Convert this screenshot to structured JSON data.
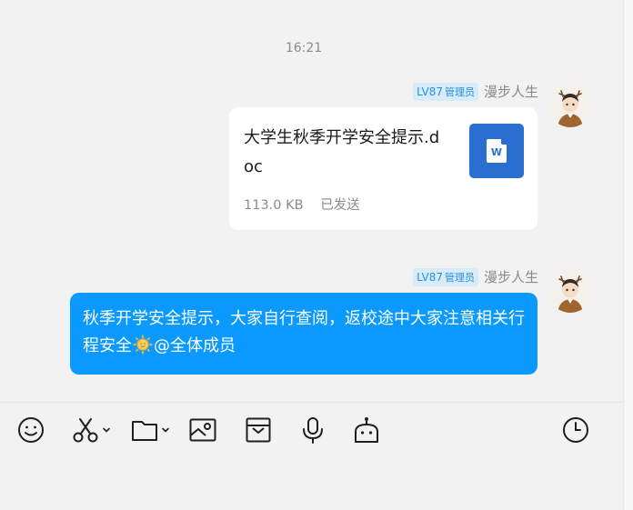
{
  "chat": {
    "timestamp": "16:21",
    "messages": [
      {
        "sender": {
          "level": "LV87",
          "role": "管理员",
          "name": "漫步人生"
        },
        "type": "file",
        "file": {
          "name": "大学生秋季开学安全提示.doc",
          "size": "113.0 KB",
          "status": "已发送",
          "icon": "word-doc-icon"
        }
      },
      {
        "sender": {
          "level": "LV87",
          "role": "管理员",
          "name": "漫步人生"
        },
        "type": "text",
        "text_before_emoji": "秋季开学安全提示，大家自行查阅，返校途中大家注意相关行程安全",
        "emoji": "sun-emoji",
        "text_after_emoji": "@全体成员"
      }
    ]
  },
  "toolbar": {
    "items": [
      "emoji-icon",
      "scissors-icon",
      "folder-icon",
      "image-icon",
      "mailbox-icon",
      "microphone-icon",
      "robot-icon",
      "clock-icon"
    ]
  },
  "colors": {
    "bubble": "#0a99fe",
    "badge_bg": "#d6ecfb",
    "badge_text": "#2b8fd6",
    "doc_icon": "#2a6ed0"
  }
}
